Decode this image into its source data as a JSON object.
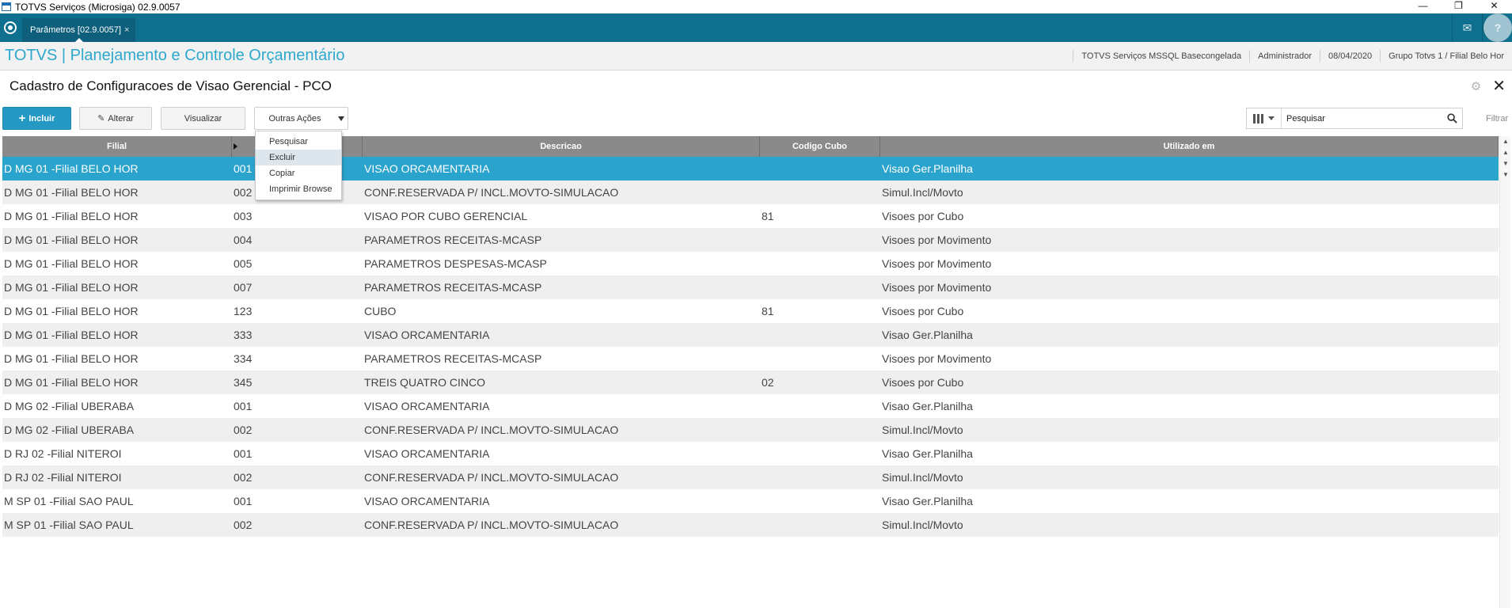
{
  "window": {
    "title": "TOTVS Serviços (Microsiga) 02.9.0057"
  },
  "tabbar": {
    "tab_label": "Parâmetros [02.9.0057]",
    "tab_close": "×"
  },
  "app_header": {
    "title": "TOTVS | Planejamento e Controle Orçamentário",
    "environment": "TOTVS Serviços MSSQL Basecongelada",
    "user": "Administrador",
    "date": "08/04/2020",
    "branch": "Grupo Totvs 1 / Filial Belo Hor"
  },
  "page": {
    "title": "Cadastro de Configuracoes de Visao Gerencial - PCO"
  },
  "toolbar": {
    "incluir": "Incluir",
    "alterar": "Alterar",
    "visualizar": "Visualizar",
    "outras_acoes": "Outras Ações",
    "search_placeholder": "Pesquisar",
    "search_value": "Pesquisar",
    "filter": "Filtrar"
  },
  "menu": {
    "items": [
      "Pesquisar",
      "Excluir",
      "Copiar",
      "Imprimir Browse"
    ],
    "hover_index": 1
  },
  "grid": {
    "columns": [
      "Filial",
      "",
      "Descricao",
      "Codigo Cubo",
      "Utilizado em"
    ],
    "selected_index": 0,
    "rows": [
      [
        "D MG 01 -Filial BELO HOR",
        "001",
        "VISAO ORCAMENTARIA",
        "",
        "Visao Ger.Planilha"
      ],
      [
        "D MG 01 -Filial BELO HOR",
        "002",
        "CONF.RESERVADA P/ INCL.MOVTO-SIMULACAO",
        "",
        "Simul.Incl/Movto"
      ],
      [
        "D MG 01 -Filial BELO HOR",
        "003",
        "VISAO POR CUBO GERENCIAL",
        "81",
        "Visoes por Cubo"
      ],
      [
        "D MG 01 -Filial BELO HOR",
        "004",
        "PARAMETROS RECEITAS-MCASP",
        "",
        "Visoes por Movimento"
      ],
      [
        "D MG 01 -Filial BELO HOR",
        "005",
        "PARAMETROS DESPESAS-MCASP",
        "",
        "Visoes por Movimento"
      ],
      [
        "D MG 01 -Filial BELO HOR",
        "007",
        "PARAMETROS RECEITAS-MCASP",
        "",
        "Visoes por Movimento"
      ],
      [
        "D MG 01 -Filial BELO HOR",
        "123",
        "CUBO",
        "81",
        "Visoes por Cubo"
      ],
      [
        "D MG 01 -Filial BELO HOR",
        "333",
        "VISAO ORCAMENTARIA",
        "",
        "Visao Ger.Planilha"
      ],
      [
        "D MG 01 -Filial BELO HOR",
        "334",
        "PARAMETROS RECEITAS-MCASP",
        "",
        "Visoes por Movimento"
      ],
      [
        "D MG 01 -Filial BELO HOR",
        "345",
        "TREIS QUATRO CINCO",
        "02",
        "Visoes por Cubo"
      ],
      [
        "D MG 02 -Filial UBERABA",
        "001",
        "VISAO ORCAMENTARIA",
        "",
        "Visao Ger.Planilha"
      ],
      [
        "D MG 02 -Filial UBERABA",
        "002",
        "CONF.RESERVADA P/ INCL.MOVTO-SIMULACAO",
        "",
        "Simul.Incl/Movto"
      ],
      [
        "D RJ 02 -Filial NITEROI",
        "001",
        "VISAO ORCAMENTARIA",
        "",
        "Visao Ger.Planilha"
      ],
      [
        "D RJ 02 -Filial NITEROI",
        "002",
        "CONF.RESERVADA P/ INCL.MOVTO-SIMULACAO",
        "",
        "Simul.Incl/Movto"
      ],
      [
        "M SP 01 -Filial SAO PAUL",
        "001",
        "VISAO ORCAMENTARIA",
        "",
        "Visao Ger.Planilha"
      ],
      [
        "M SP 01 -Filial SAO PAUL",
        "002",
        "CONF.RESERVADA P/ INCL.MOVTO-SIMULACAO",
        "",
        "Simul.Incl/Movto"
      ]
    ]
  },
  "colors": {
    "accent": "#2399c3",
    "tabbar": "#0f6f8f",
    "selected_row": "#2aa3cd",
    "header_title": "#2ea8cc"
  }
}
